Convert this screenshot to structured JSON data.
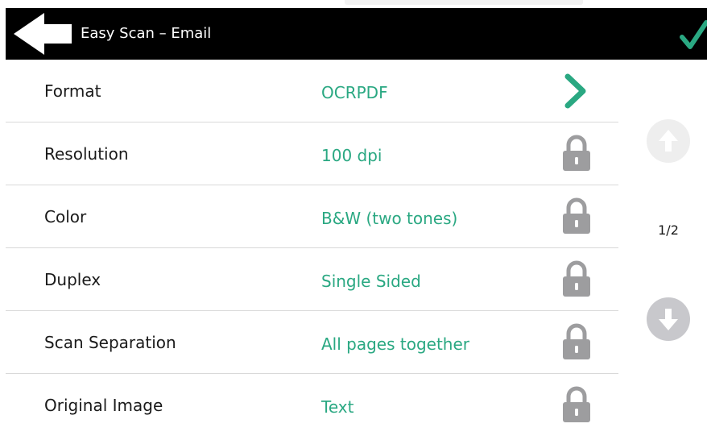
{
  "header": {
    "title": "Easy Scan – Email",
    "back_icon": "back-arrow-icon",
    "confirm_icon": "checkmark-icon"
  },
  "settings": [
    {
      "label": "Format",
      "value": "OCRPDF",
      "icon": "chevron-right-icon",
      "editable": true
    },
    {
      "label": "Resolution",
      "value": "100 dpi",
      "icon": "lock-icon",
      "editable": false
    },
    {
      "label": "Color",
      "value": "B&W (two tones)",
      "icon": "lock-icon",
      "editable": false
    },
    {
      "label": "Duplex",
      "value": "Single Sided",
      "icon": "lock-icon",
      "editable": false
    },
    {
      "label": "Scan Separation",
      "value": "All pages together",
      "icon": "lock-icon",
      "editable": false
    },
    {
      "label": "Original Image",
      "value": "Text",
      "icon": "lock-icon",
      "editable": false
    }
  ],
  "pagination": {
    "indicator": "1/2",
    "up_icon": "arrow-up-icon",
    "down_icon": "arrow-down-icon"
  },
  "colors": {
    "header_bg": "#000000",
    "accent": "#2aa882",
    "lock": "#9d9d9f",
    "scroll_disabled": "#eeeeee",
    "scroll_enabled": "#c8c8cc"
  }
}
